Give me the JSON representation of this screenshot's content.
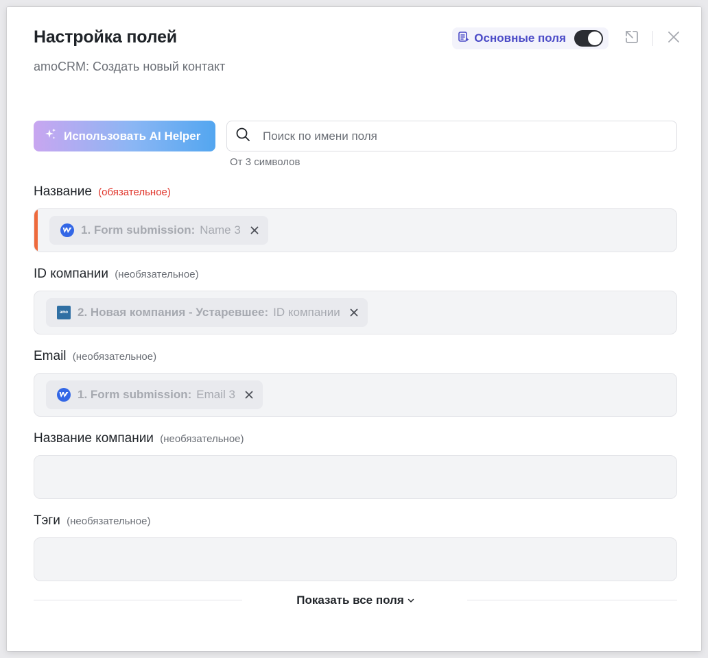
{
  "header": {
    "title": "Настройка полей",
    "subtitle": "amoCRM: Создать новый контакт",
    "basic_fields_label": "Основные поля",
    "basic_fields_enabled": true
  },
  "toolbar": {
    "ai_helper_label": "Использовать AI Helper",
    "search_placeholder": "Поиск по имени поля",
    "search_value": "",
    "search_hint": "От 3 символов"
  },
  "fields": [
    {
      "label": "Название",
      "note": "(обязательное)",
      "required": true,
      "chip": {
        "source": "1. Form submission:",
        "value": "Name 3",
        "icon": "webflow-icon"
      }
    },
    {
      "label": "ID компании",
      "note": "(необязательное)",
      "required": false,
      "chip": {
        "source": "2. Новая компания - Устаревшее:",
        "value": "ID компании",
        "icon": "amocrm-icon"
      }
    },
    {
      "label": "Email",
      "note": "(необязательное)",
      "required": false,
      "chip": {
        "source": "1. Form submission:",
        "value": "Email 3",
        "icon": "webflow-icon"
      }
    },
    {
      "label": "Название компании",
      "note": "(необязательное)",
      "required": false,
      "chip": null
    },
    {
      "label": "Тэги",
      "note": "(необязательное)",
      "required": false,
      "chip": null
    }
  ],
  "footer": {
    "show_all_label": "Показать все поля"
  },
  "colors": {
    "accent": "#4b4bc7",
    "required": "#e0352b",
    "required_bar": "#ee6a3c",
    "webflow": "#3367e6"
  }
}
